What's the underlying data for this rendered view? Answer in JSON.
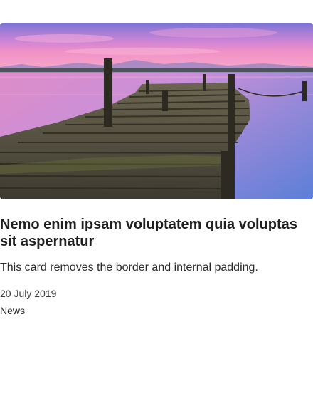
{
  "card": {
    "image_description_icon": "photo-image",
    "title": "Nemo enim ipsam voluptatem quia voluptas sit aspernatur",
    "text": "This card removes the border and internal padding.",
    "date": "20 July 2019",
    "category": "News"
  },
  "colors": {
    "sky_top": "#7c6fd0",
    "sky_pink": "#f28ac8",
    "water": "#6a8bd9",
    "title": "#1f1f1f"
  }
}
